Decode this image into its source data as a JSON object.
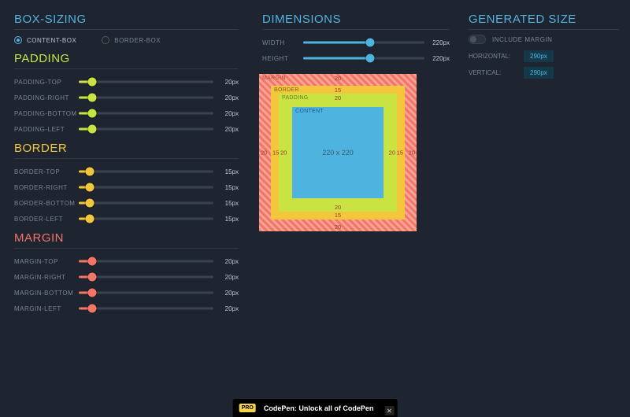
{
  "boxSizing": {
    "heading": "BOX-SIZING",
    "options": [
      {
        "label": "CONTENT-BOX",
        "selected": true
      },
      {
        "label": "BORDER-BOX",
        "selected": false
      }
    ]
  },
  "padding": {
    "heading": "PADDING",
    "rows": [
      {
        "label": "PADDING-TOP",
        "value": "20px",
        "pct": 10
      },
      {
        "label": "PADDING-RIGHT",
        "value": "20px",
        "pct": 10
      },
      {
        "label": "PADDING-BOTTOM",
        "value": "20px",
        "pct": 10
      },
      {
        "label": "PADDING-LEFT",
        "value": "20px",
        "pct": 10
      }
    ]
  },
  "border": {
    "heading": "BORDER",
    "rows": [
      {
        "label": "BORDER-TOP",
        "value": "15px",
        "pct": 8
      },
      {
        "label": "BORDER-RIGHT",
        "value": "15px",
        "pct": 8
      },
      {
        "label": "BORDER-BOTTOM",
        "value": "15px",
        "pct": 8
      },
      {
        "label": "BORDER-LEFT",
        "value": "15px",
        "pct": 8
      }
    ]
  },
  "margin": {
    "heading": "MARGIN",
    "rows": [
      {
        "label": "MARGIN-TOP",
        "value": "20px",
        "pct": 10
      },
      {
        "label": "MARGIN-RIGHT",
        "value": "20px",
        "pct": 10
      },
      {
        "label": "MARGIN-BOTTOM",
        "value": "20px",
        "pct": 10
      },
      {
        "label": "MARGIN-LEFT",
        "value": "20px",
        "pct": 10
      }
    ]
  },
  "dimensions": {
    "heading": "DIMENSIONS",
    "rows": [
      {
        "label": "WIDTH",
        "value": "220px",
        "pct": 55
      },
      {
        "label": "HEIGHT",
        "value": "220px",
        "pct": 55
      }
    ]
  },
  "generated": {
    "heading": "GENERATED SIZE",
    "includeMarginLabel": "INCLUDE MARGIN",
    "includeMargin": false,
    "rows": [
      {
        "label": "HORIZONTAL:",
        "value": "290px"
      },
      {
        "label": "VERTICAL:",
        "value": "290px"
      }
    ]
  },
  "box": {
    "labels": {
      "margin": "MARGIN",
      "border": "BORDER",
      "padding": "PADDING",
      "content": "CONTENT"
    },
    "contentText": "220 x 220",
    "margin": {
      "top": "20",
      "right": "20",
      "bottom": "20",
      "left": "20"
    },
    "border": {
      "top": "15",
      "right": "15",
      "bottom": "15",
      "left": "15"
    },
    "padding": {
      "top": "20",
      "right": "20",
      "bottom": "20",
      "left": "20"
    }
  },
  "footer": {
    "badge": "PRO",
    "text": "CodePen: Unlock all of CodePen"
  }
}
